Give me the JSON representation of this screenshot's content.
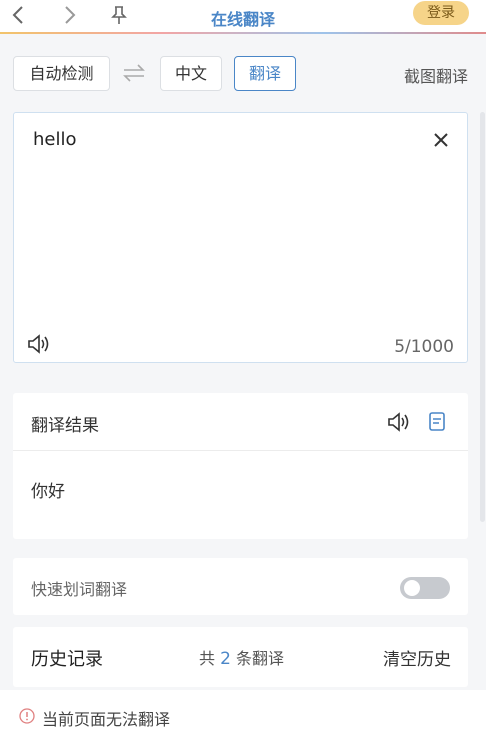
{
  "header": {
    "title": "在线翻译",
    "login_label": "登录",
    "icons": [
      "chevron-left-icon",
      "chevron-right-icon",
      "pin-icon"
    ]
  },
  "languages": {
    "source": "自动检测",
    "target": "中文",
    "translate_button": "翻译",
    "screenshot_translate": "截图翻译",
    "swap_icon": "swap-arrows-icon"
  },
  "input": {
    "text": "hello",
    "counter": "5/1000"
  },
  "result": {
    "title": "翻译结果",
    "text": "你好"
  },
  "quick_translate": {
    "label": "快速划词翻译",
    "enabled": false
  },
  "history": {
    "title": "历史记录",
    "count_prefix": "共",
    "count": "2",
    "count_suffix": "条翻译",
    "clear_label": "清空历史"
  },
  "footer": {
    "message": "当前页面无法翻译"
  },
  "colors": {
    "accent": "#4a86c7",
    "login_bg": "#f6d489",
    "toggle_off": "#c7cacf"
  }
}
